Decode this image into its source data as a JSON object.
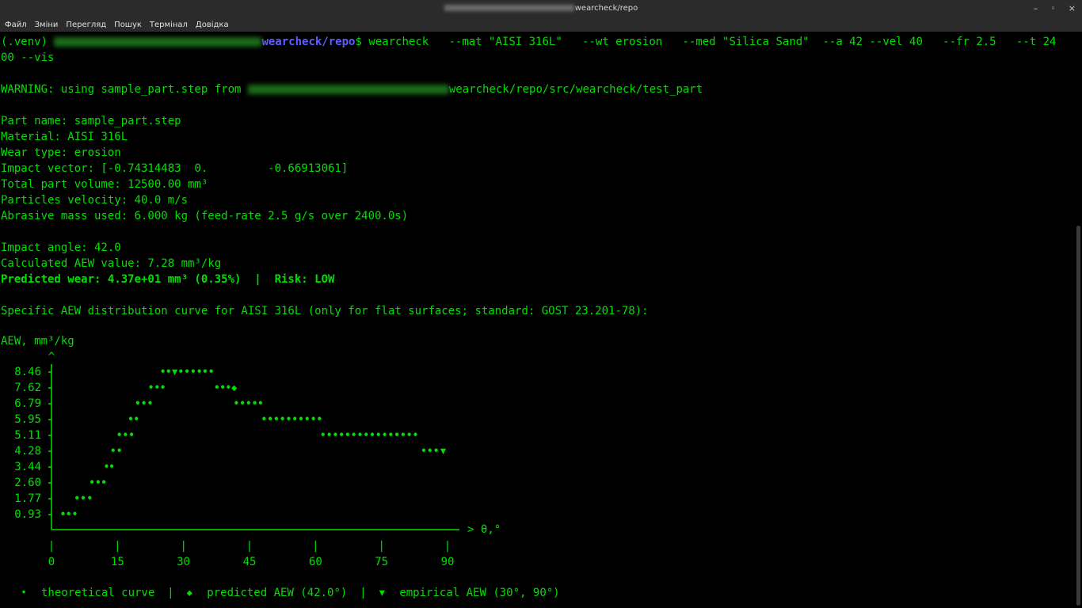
{
  "window": {
    "title_path": "wearcheck/repo",
    "buttons": [
      "–",
      "◦",
      "×"
    ]
  },
  "menu": [
    "Файл",
    "Зміни",
    "Перегляд",
    "Пошук",
    "Термінал",
    "Довідка"
  ],
  "command": {
    "venv": "(.venv) ",
    "cwd_visible": "wearcheck/repo",
    "prompt_symbol": "$ ",
    "cmd": "wearcheck   --mat \"AISI 316L\"   --wt erosion   --med \"Silica Sand\"  --a 42 --vel 40   --fr 2.5   --t 24",
    "cmd_wrap": "00 --vis"
  },
  "warning": {
    "prefix": "WARNING: using sample_part.step from ",
    "suffix": "wearcheck/repo/src/wearcheck/test_part"
  },
  "info": [
    "Part name: sample_part.step",
    "Material: AISI 316L",
    "Wear type: erosion",
    "Impact vector: [-0.74314483  0.         -0.66913061]",
    "Total part volume: 12500.00 mm³",
    "Particles velocity: 40.0 m/s",
    "Abrasive mass used: 6.000 kg (feed-rate 2.5 g/s over 2400.0s)"
  ],
  "results": {
    "impact_angle": "Impact angle: 42.0",
    "aew_value": "Calculated AEW value: 7.28 mm³/kg",
    "predicted": "Predicted wear: 4.37e+01 mm³ (0.35%)  |  Risk: LOW"
  },
  "curve_heading": "Specific AEW distribution curve for AISI 316L (only for flat surfaces; standard: GOST 23.201-78):",
  "chart_data": {
    "type": "scatter",
    "ylabel": "AEW, mm³/kg",
    "xlabel": "θ,°",
    "y_axis_arrow": "^",
    "x_axis_arrow": ">",
    "xlim": [
      0,
      90
    ],
    "ylim": [
      0.93,
      8.46
    ],
    "x_ticks": [
      "0",
      "15",
      "30",
      "45",
      "60",
      "75",
      "90"
    ],
    "y_ticks": [
      "8.46",
      "7.62",
      "6.79",
      "5.95",
      "5.11",
      "4.28",
      "3.44",
      "2.60",
      "1.77",
      "0.93"
    ],
    "series": [
      {
        "name": "theoretical curve",
        "marker": "•",
        "color": "#00e000",
        "points": [
          [
            2.6,
            0.93
          ],
          [
            3.9,
            0.93
          ],
          [
            5.3,
            0.93
          ],
          [
            5.8,
            1.77
          ],
          [
            7.2,
            1.77
          ],
          [
            8.7,
            1.77
          ],
          [
            9.2,
            2.6
          ],
          [
            10.6,
            2.6
          ],
          [
            11.9,
            2.6
          ],
          [
            12.5,
            3.44
          ],
          [
            13.7,
            3.44
          ],
          [
            14.0,
            4.28
          ],
          [
            15.4,
            4.28
          ],
          [
            15.4,
            5.11
          ],
          [
            16.8,
            5.11
          ],
          [
            18.2,
            5.11
          ],
          [
            18.0,
            5.95
          ],
          [
            19.3,
            5.95
          ],
          [
            19.6,
            6.79
          ],
          [
            21.0,
            6.79
          ],
          [
            22.4,
            6.79
          ],
          [
            22.6,
            7.62
          ],
          [
            24.0,
            7.62
          ],
          [
            25.3,
            7.62
          ],
          [
            25.3,
            8.46
          ],
          [
            26.6,
            8.46
          ],
          [
            29.4,
            8.46
          ],
          [
            30.8,
            8.46
          ],
          [
            32.2,
            8.46
          ],
          [
            33.6,
            8.46
          ],
          [
            34.9,
            8.46
          ],
          [
            36.3,
            8.46
          ],
          [
            37.6,
            7.62
          ],
          [
            38.9,
            7.62
          ],
          [
            40.2,
            7.62
          ],
          [
            42.0,
            6.79
          ],
          [
            43.4,
            6.79
          ],
          [
            44.8,
            6.79
          ],
          [
            46.2,
            6.79
          ],
          [
            47.5,
            6.79
          ],
          [
            48.3,
            5.95
          ],
          [
            49.7,
            5.95
          ],
          [
            51.1,
            5.95
          ],
          [
            52.5,
            5.95
          ],
          [
            53.9,
            5.95
          ],
          [
            55.3,
            5.95
          ],
          [
            56.7,
            5.95
          ],
          [
            58.1,
            5.95
          ],
          [
            59.5,
            5.95
          ],
          [
            60.9,
            5.95
          ],
          [
            61.7,
            5.11
          ],
          [
            63.1,
            5.11
          ],
          [
            64.5,
            5.11
          ],
          [
            65.9,
            5.11
          ],
          [
            67.3,
            5.11
          ],
          [
            68.7,
            5.11
          ],
          [
            70.1,
            5.11
          ],
          [
            71.5,
            5.11
          ],
          [
            72.9,
            5.11
          ],
          [
            74.3,
            5.11
          ],
          [
            75.7,
            5.11
          ],
          [
            77.1,
            5.11
          ],
          [
            78.5,
            5.11
          ],
          [
            79.9,
            5.11
          ],
          [
            81.3,
            5.11
          ],
          [
            82.7,
            5.11
          ],
          [
            84.6,
            4.28
          ],
          [
            86.0,
            4.28
          ],
          [
            87.4,
            4.28
          ]
        ]
      },
      {
        "name": "predicted AEW (42.0°)",
        "marker": "◆",
        "color": "#00e000",
        "points": [
          [
            41.5,
            7.62
          ]
        ]
      },
      {
        "name": "empirical AEW (30°, 90°)",
        "marker": "▼",
        "color": "#00e000",
        "points": [
          [
            28.0,
            8.46
          ],
          [
            89.0,
            4.28
          ]
        ]
      }
    ],
    "legend": [
      {
        "marker": "•",
        "label": "theoretical curve"
      },
      {
        "marker": "◆",
        "label": "predicted AEW (42.0°)"
      },
      {
        "marker": "▼",
        "label": "empirical AEW (30°, 90°)"
      }
    ],
    "legend_separator": "|",
    "legend_position": "bottom",
    "grid": false
  }
}
